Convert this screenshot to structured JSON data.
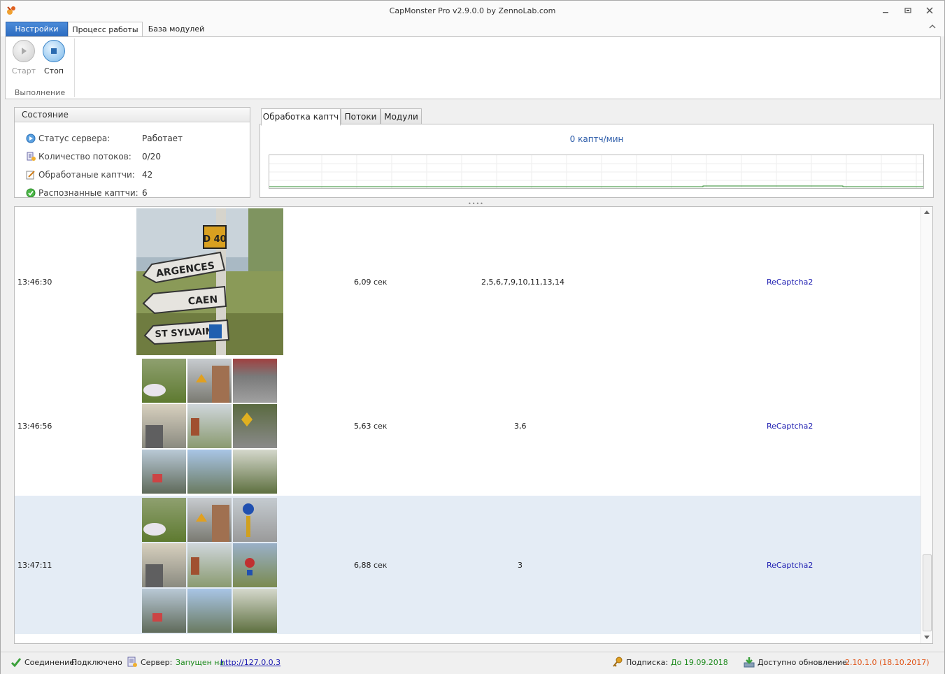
{
  "window": {
    "title": "CapMonster Pro v2.9.0.0 by ZennoLab.com"
  },
  "ribbon": {
    "tabs": [
      "Настройки",
      "Процесс работы",
      "База модулей"
    ],
    "start_label": "Старт",
    "stop_label": "Стоп",
    "group_label": "Выполнение"
  },
  "state": {
    "header": "Состояние",
    "rows": [
      {
        "label": "Статус сервера:",
        "value": "Работает"
      },
      {
        "label": "Количество потоков:",
        "value": "0/20"
      },
      {
        "label": "Обработаные каптчи:",
        "value": "42"
      },
      {
        "label": "Распознанные каптчи:",
        "value": "6"
      }
    ]
  },
  "content_tabs": [
    "Обработка каптч",
    "Потоки",
    "Модули"
  ],
  "rate_text": "0 каптч/мин",
  "log": [
    {
      "time": "13:46:30",
      "duration": "6,09 сек",
      "answer": "2,5,6,7,9,10,11,13,14",
      "type": "ReCaptcha2"
    },
    {
      "time": "13:46:56",
      "duration": "5,63 сек",
      "answer": "3,6",
      "type": "ReCaptcha2"
    },
    {
      "time": "13:47:11",
      "duration": "6,88 сек",
      "answer": "3",
      "type": "ReCaptcha2"
    }
  ],
  "sign_text": {
    "road": "D 40",
    "line1": "ARGENCES",
    "line2": "CAEN",
    "line3": "ST SYLVAIN"
  },
  "statusbar": {
    "connection_label": "Соединение:",
    "connection_value": "Подключено",
    "server_label": "Сервер:",
    "server_value": "Запущен на",
    "server_url": "http://127.0.0.3",
    "subscription_label": "Подписка:",
    "subscription_value": "До 19.09.2018",
    "update_label": "Доступно обновление:",
    "update_value": "2.10.1.0 (18.10.2017)"
  },
  "colors": {
    "accent": "#2d6cc0",
    "ok_green": "#1d8a1d",
    "update_orange": "#e0561b",
    "selected_row": "#e4ecf5"
  }
}
